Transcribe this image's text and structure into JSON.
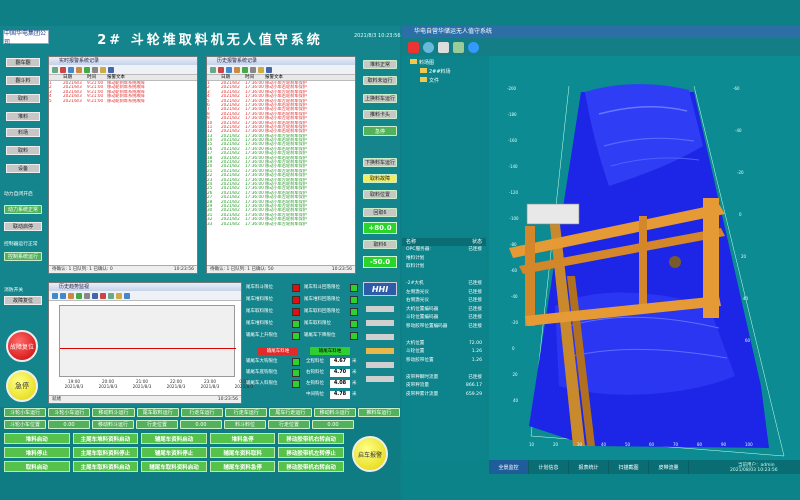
{
  "header": {
    "logo": "中国华电集团公司",
    "title": "2# 斗轮堆取料机无人值守系统",
    "datetime": "2021/8/3 10:23:56"
  },
  "left_buttons": [
    "翻车翻",
    "翻斗料",
    "取料",
    "堆料",
    "料场",
    "取料",
    "设备"
  ],
  "left_labels": {
    "status1": "动力自闭开启",
    "status2": "动力系统正常",
    "status3": "联动启停",
    "status4": "控制器运行正常",
    "status5": "控制系统运行",
    "status6": "消防开关",
    "status7": "故障复位"
  },
  "emergency": {
    "fault_reset": "故障复位",
    "emergency_stop": "急停"
  },
  "panel1": {
    "title": "实时报警系统记录",
    "headers": [
      "日期",
      "时间",
      "报警文本"
    ],
    "rows": [
      [
        "2021/8/3",
        "9:21:00",
        "移动轮刹车系统故障"
      ],
      [
        "2021/8/3",
        "9:21:00",
        "移动轮刹车系统故障"
      ],
      [
        "2021/8/3",
        "9:21:00",
        "移动轮刹车系统故障"
      ],
      [
        "2021/8/3",
        "9:21:00",
        "移动轮刹车系统故障"
      ],
      [
        "2021/8/3",
        "9:21:00",
        "移动轮刹车系统故障"
      ]
    ],
    "status": "待确认: 1   已队列: 1   已确认: 0",
    "clock": "10:23:56"
  },
  "panel2": {
    "title": "历史报警系统记录",
    "headers": [
      "日期",
      "时间",
      "报警文本"
    ],
    "status": "待确认: 1   已队列: 1   已确认: 50",
    "clock": "10:23:56",
    "rows_red": [
      "移动小车左轮刹车保护",
      "移动小车右轮刹车保护",
      "移动小车左轮刹车保护",
      "移动小车右轮刹车保护",
      "移动小车左轮刹车保护",
      "移动小车右轮刹车保护",
      "移动小车左轮刹车保护",
      "移动小车右轮刹车保护",
      "移动小车左轮刹车保护",
      "移动小车右轮刹车保护",
      "移动小车左轮刹车保护",
      "移动小车右轮刹车保护"
    ],
    "rows_green": [
      "移动小车左轮刹车保护",
      "移动小车右轮刹车保护",
      "移动小车左轮刹车保护",
      "移动小车右轮刹车保护",
      "移动小车左轮刹车保护",
      "移动小车右轮刹车保护",
      "移动小车左轮刹车保护",
      "移动小车右轮刹车保护",
      "移动小车左轮刹车保护",
      "移动小车右轮刹车保护",
      "移动小车左轮刹车保护",
      "移动小车右轮刹车保护",
      "移动小车左轮刹车保护",
      "移动小车右轮刹车保护",
      "移动小车左轮刹车保护",
      "移动小车右轮刹车保护",
      "移动小车左轮刹车保护",
      "移动小车右轮刹车保护",
      "移动小车左轮刹车保护",
      "移动小车右轮刹车保护",
      "移动小车左轮刹车保护"
    ],
    "dates": "2021/8/2",
    "times": "17:36:00"
  },
  "panel3": {
    "title": "历史趋势监视",
    "xticks": [
      "19:00",
      "20:00",
      "21:00",
      "22:00",
      "23:00",
      "0:00"
    ],
    "xdates": [
      "2021/8/3",
      "2021/8/3",
      "2021/8/3",
      "2021/8/3",
      "2021/8/3",
      "2021/8/3"
    ],
    "status": "就绪",
    "clock": "10:23:56"
  },
  "signals": [
    {
      "l": "尾车料斗限位",
      "r": "尾车料斗回落限位"
    },
    {
      "l": "尾车堆料限位",
      "r": "尾车堆料回落限位"
    },
    {
      "l": "尾车取料限位",
      "r": "尾车取料回落限位"
    },
    {
      "l": "尾车堆料限位",
      "r": "尾车取料限位"
    },
    {
      "l": "输尾车上升限位",
      "r": "输尾车下降限位"
    }
  ],
  "redbox1": "输尾车料堆",
  "redbox2": "输尾车料堆",
  "valrows": [
    {
      "l": "输尾车大钩限位",
      "r": "全程料位",
      "v": "4.67",
      "u": "米"
    },
    {
      "l": "输尾车底钩限位",
      "r": "右钩料位",
      "v": "4.70",
      "u": "米"
    },
    {
      "l": "输尾车入料限位",
      "r": "左钩料位",
      "v": "4.08",
      "u": "米"
    },
    {
      "l": "",
      "r": "中间钩位",
      "v": "4.78",
      "u": "米"
    }
  ],
  "right_side_btns": [
    "堆料正常",
    "取料未运行",
    "上换料车运行",
    "推料卡头",
    "急停",
    "下换料车运行",
    "取料故障",
    "取料位置",
    "回取6",
    "+80.0",
    "取料6",
    "-50.0"
  ],
  "hhi": "HHI",
  "bottom_row1": [
    "斗轮运行"
  ],
  "bottom": {
    "r1": [
      "斗轮小车运行",
      "斗轮小车运行",
      "移动料斗运行",
      "尾车取料运行",
      "行走车运行",
      "行走车运行",
      "尾车行走运行",
      "移动料斗运行",
      "推料车运行"
    ],
    "r2": [
      "斗轮小车位置",
      "0.00",
      "移动料斗运行",
      "行走位置",
      "0.00",
      "料斗料位",
      "行走位置",
      "0.00"
    ],
    "r3": [
      "堆料启动",
      "主尾车堆料资料启动",
      "辅尾车资料启动",
      "堆料急停",
      "移动胶带机右转启动"
    ],
    "r4": [
      "堆料停止",
      "主尾车取料资料停止",
      "辅尾车资料停止",
      "辅尾车资料取料",
      "移动胶带机左转停止"
    ],
    "r5": [
      "取料启动",
      "主尾车取料资料启动",
      "辅尾车取料资料启动",
      "辅尾车资料急停",
      "移动胶带机右转启动"
    ],
    "alarm": "启车报警"
  },
  "right": {
    "title": "华电自营华储运无人值守系统",
    "tree": [
      "料场图",
      "2##料场",
      "文件"
    ],
    "info_headers": [
      "名称",
      "状态"
    ],
    "info": [
      [
        "OPC服务器:",
        "已连接"
      ],
      [
        "堆料计划",
        ""
      ],
      [
        "取料计划",
        ""
      ],
      [
        "",
        ""
      ],
      [
        "-2#大机",
        "已连接"
      ],
      [
        "左侧激光仪",
        "已连接"
      ],
      [
        "右侧激光仪",
        "已连接"
      ],
      [
        "大机位置编码器",
        "已连接"
      ],
      [
        "斗轮位置编码器",
        "已连接"
      ],
      [
        "移动胶带位置编码器",
        "已连接"
      ],
      [
        "",
        ""
      ],
      [
        "大机位置",
        "72.00"
      ],
      [
        "斗轮位置",
        "1.26"
      ],
      [
        "移动胶带位置",
        "1.26"
      ],
      [
        "",
        ""
      ],
      [
        "皮带秤瞬时流量",
        "已连接"
      ],
      [
        "皮带秤流量",
        "866.17"
      ],
      [
        "皮带秤累计流量",
        "659.29"
      ]
    ],
    "tabs": [
      "全景监控",
      "计划信息",
      "报表统计",
      "扫描截图",
      "皮带流量"
    ],
    "footer_user": "当前用户：admin",
    "footer_time": "2021/08/03 10:23:56",
    "axis": {
      "ticks_left": [
        "-200",
        "-180",
        "-160",
        "-140",
        "-120",
        "-100",
        "-80",
        "-60",
        "-40",
        "-20",
        "0",
        "20",
        "40"
      ],
      "ticks_right": [
        "-60",
        "-40",
        "-20",
        "0",
        "20",
        "40",
        "60"
      ],
      "ticks_bottom": [
        "10",
        "20",
        "30",
        "40",
        "50",
        "60",
        "70",
        "80",
        "90",
        "100"
      ]
    }
  }
}
